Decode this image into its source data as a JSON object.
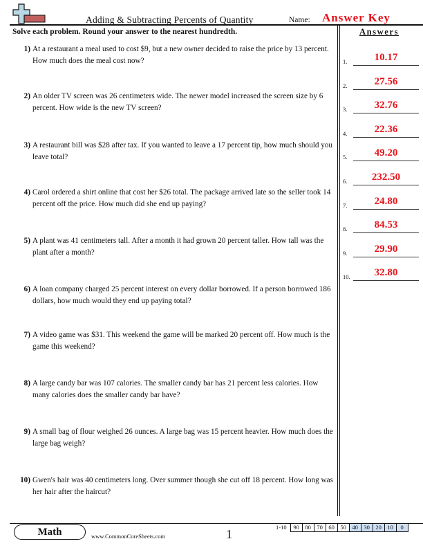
{
  "header": {
    "title": "Adding & Subtracting Percents of Quantity",
    "name_label": "Name:",
    "name_value": "Answer Key",
    "logo_icon": "plus-minus-logo-icon"
  },
  "instructions": "Solve each problem. Round your answer to the nearest hundredth.",
  "answers_heading": "Answers",
  "questions": [
    {
      "num": "1)",
      "text": "At a restaurant a meal used to cost $9, but a new owner decided to raise the price by 13 percent. How much does the meal cost now?"
    },
    {
      "num": "2)",
      "text": "An older TV screen was 26 centimeters wide. The newer model increased the screen size by 6 percent. How wide is the new TV screen?"
    },
    {
      "num": "3)",
      "text": "A restaurant bill was $28 after tax. If you wanted to leave a 17 percent tip, how much should you leave total?"
    },
    {
      "num": "4)",
      "text": "Carol ordered a shirt online that cost her $26 total. The package arrived late so the seller took 14 percent off the price. How much did she end up paying?"
    },
    {
      "num": "5)",
      "text": "A plant was 41 centimeters tall. After a month it had grown 20 percent taller. How tall was the plant after a month?"
    },
    {
      "num": "6)",
      "text": "A loan company charged 25 percent interest on every dollar borrowed. If a person borrowed 186 dollars, how much would they end up paying total?"
    },
    {
      "num": "7)",
      "text": "A video game was $31. This weekend the game will be marked 20 percent off. How much is the game this weekend?"
    },
    {
      "num": "8)",
      "text": "A large candy bar was 107 calories. The smaller candy bar has 21 percent less calories. How many calories does the smaller candy bar have?"
    },
    {
      "num": "9)",
      "text": "A small bag of flour weighed 26 ounces. A large bag was 15 percent heavier. How much does the large bag weigh?"
    },
    {
      "num": "10)",
      "text": "Gwen's hair was 40 centimeters long. Over summer though she cut off 18 percent. How long was her hair after the haircut?"
    }
  ],
  "answers": [
    {
      "num": "1.",
      "value": "10.17"
    },
    {
      "num": "2.",
      "value": "27.56"
    },
    {
      "num": "3.",
      "value": "32.76"
    },
    {
      "num": "4.",
      "value": "22.36"
    },
    {
      "num": "5.",
      "value": "49.20"
    },
    {
      "num": "6.",
      "value": "232.50"
    },
    {
      "num": "7.",
      "value": "24.80"
    },
    {
      "num": "8.",
      "value": "84.53"
    },
    {
      "num": "9.",
      "value": "29.90"
    },
    {
      "num": "10.",
      "value": "32.80"
    }
  ],
  "footer": {
    "subject": "Math",
    "site": "www.CommonCoreSheets.com",
    "page": "1",
    "score_label": "1-10",
    "scores": [
      "90",
      "80",
      "70",
      "60",
      "50",
      "40",
      "30",
      "20",
      "10",
      "0"
    ]
  },
  "colors": {
    "answer_red": "#e8141c",
    "low_score_fill": "#cfe0f5"
  }
}
